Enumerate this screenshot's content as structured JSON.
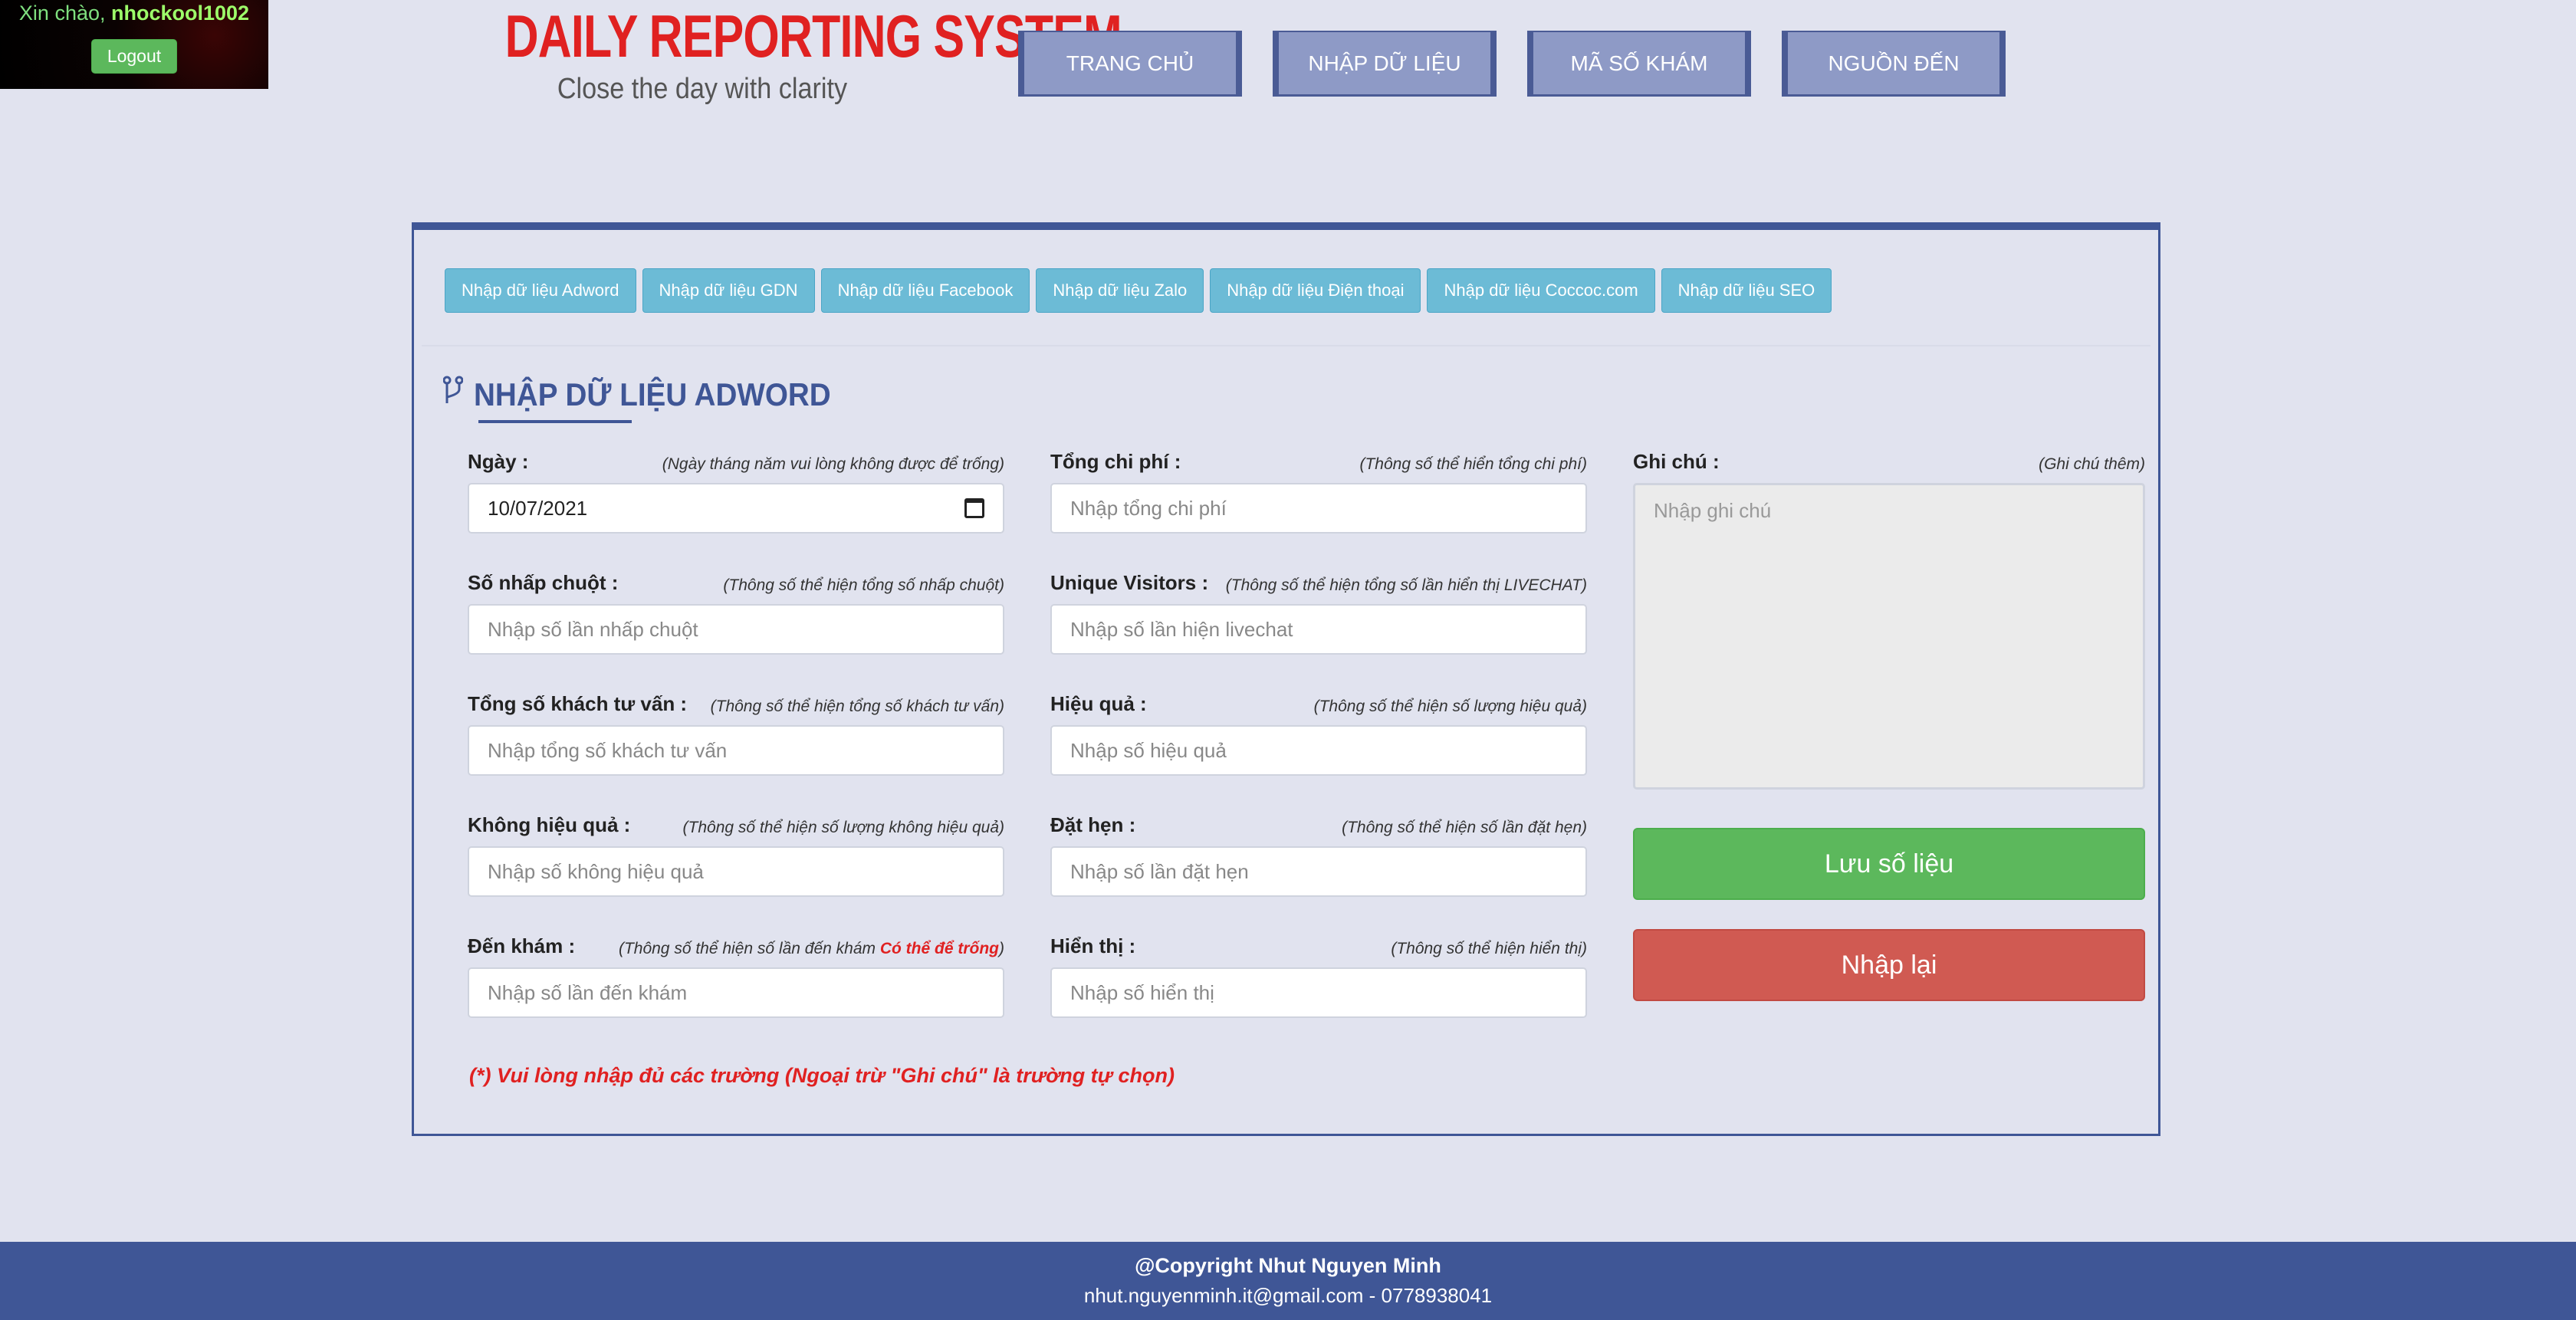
{
  "user": {
    "greeting": "Xin chào, ",
    "username": "nhockool1002",
    "logout_label": "Logout"
  },
  "header": {
    "title": "DAILY REPORTING SYSTEM",
    "slogan": "Close the day with clarity"
  },
  "nav": [
    "TRANG CHỦ",
    "NHẬP DỮ LIỆU",
    "MÃ SỐ KHÁM",
    "NGUỒN ĐẾN"
  ],
  "subnav": [
    "Nhập dữ liệu Adword",
    "Nhập dữ liệu GDN",
    "Nhập dữ liệu Facebook",
    "Nhập dữ liệu Zalo",
    "Nhập dữ liệu Điện thoại",
    "Nhập dữ liệu Coccoc.com",
    "Nhập dữ liệu SEO"
  ],
  "section": {
    "title": "NHẬP DỮ LIỆU ADWORD"
  },
  "form": {
    "date": {
      "label": "Ngày :",
      "hint": "(Ngày tháng năm vui lòng không được để trống)",
      "value": "10/07/2021"
    },
    "total_cost": {
      "label": "Tổng chi phí :",
      "hint": "(Thông số thể hiển tổng chi phí)",
      "placeholder": "Nhập tổng chi phí"
    },
    "clicks": {
      "label": "Số nhấp chuột :",
      "hint": "(Thông số thể hiện tổng số nhấp chuột)",
      "placeholder": "Nhập số lần nhấp chuột"
    },
    "unique_visitors": {
      "label": "Unique Visitors :",
      "hint": "(Thông số thể hiện tổng số lần hiển thị LIVECHAT)",
      "placeholder": "Nhập số lần hiện livechat"
    },
    "consult": {
      "label": "Tổng số khách tư vấn :",
      "hint": "(Thông số thể hiện tổng số khách tư vấn)",
      "placeholder": "Nhập tổng số khách tư vấn"
    },
    "effective": {
      "label": "Hiệu quả :",
      "hint": "(Thông số thể hiện số lượng hiệu quả)",
      "placeholder": "Nhập số hiệu quả"
    },
    "ineffective": {
      "label": "Không hiệu quả :",
      "hint": "(Thông số thể hiện số lượng không hiệu quả)",
      "placeholder": "Nhập số không hiệu quả"
    },
    "appointment": {
      "label": "Đặt hẹn :",
      "hint": "(Thông số thể hiện số lần đặt hẹn)",
      "placeholder": "Nhập số lần đặt hẹn"
    },
    "visit": {
      "label": "Đến khám :",
      "hint": "(Thông số thể hiện số lần đến khám ",
      "hint_warn": "Có thể để trống",
      "hint_end": ")",
      "placeholder": "Nhập số lần đến khám"
    },
    "display": {
      "label": "Hiển thị :",
      "hint": "(Thông số thể hiện hiển thị)",
      "placeholder": "Nhập số hiển thị"
    },
    "notes": {
      "label": "Ghi chú :",
      "hint": "(Ghi chú thêm)",
      "placeholder": "Nhập ghi chú"
    },
    "save_label": "Lưu số liệu",
    "reset_label": "Nhập lại",
    "required_note": "(*) Vui lòng nhập đủ các trường (Ngoại trừ \"Ghi chú\" là trường tự chọn)"
  },
  "footer": {
    "copyright": "@Copyright Nhut Nguyen Minh",
    "contact": "nhut.nguyenminh.it@gmail.com - 0778938041"
  },
  "colors": {
    "primary": "#3f5696",
    "danger": "#d05a52",
    "success": "#5cb85c",
    "info": "#6cbbd6",
    "title_red": "#e02121"
  }
}
